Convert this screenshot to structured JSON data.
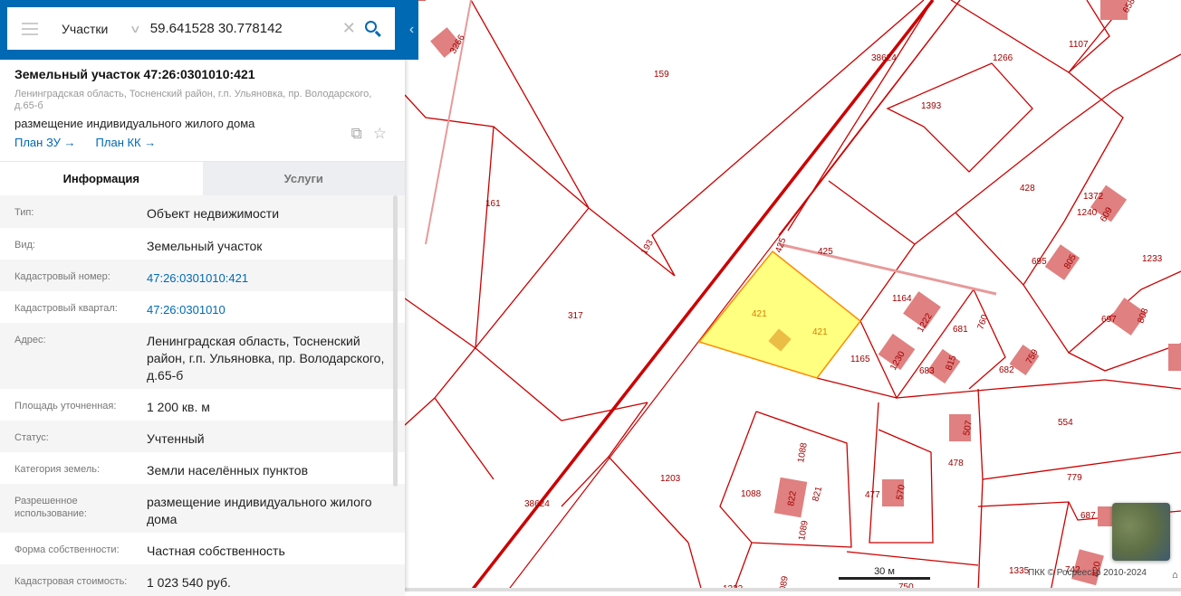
{
  "search": {
    "category": "Участки",
    "query": "59.641528 30.778142"
  },
  "card": {
    "title": "Земельный участок 47:26:0301010:421",
    "address": "Ленинградская область, Тосненский район, г.п. Ульяновка, пр. Володарского, д.65-б",
    "use": "размещение индивидуального жилого дома",
    "link_zu": "План ЗУ →",
    "link_kk": "План КК →"
  },
  "tabs": {
    "info": "Информация",
    "services": "Услуги"
  },
  "rows": [
    {
      "label": "Тип:",
      "value": "Объект недвижимости"
    },
    {
      "label": "Вид:",
      "value": "Земельный участок"
    },
    {
      "label": "Кадастровый номер:",
      "value": "47:26:0301010:421"
    },
    {
      "label": "Кадастровый квартал:",
      "value": "47:26:0301010"
    },
    {
      "label": "Адрес:",
      "value": "Ленинградская область, Тосненский район, г.п. Ульяновка, пр. Володарского, д.65-б"
    },
    {
      "label": "Площадь уточненная:",
      "value": "1 200 кв. м"
    },
    {
      "label": "Статус:",
      "value": "Учтенный"
    },
    {
      "label": "Категория земель:",
      "value": "Земли населённых пунктов"
    },
    {
      "label": "Разрешенное использование:",
      "value": "размещение индивидуального жилого дома"
    },
    {
      "label": "Форма собственности:",
      "value": "Частная собственность"
    },
    {
      "label": "Кадастровая стоимость:",
      "value": "1 023 540 руб."
    }
  ],
  "map": {
    "scale": "30 м",
    "attribution": "ПКК © Росреестр 2010-2024",
    "labels": [
      "159",
      "38624",
      "1266",
      "1107",
      "1393",
      "161",
      "428",
      "1372",
      "1240",
      "609",
      "193",
      "425",
      "425",
      "695",
      "805",
      "1233",
      "317",
      "421",
      "421",
      "1164",
      "1222",
      "681",
      "760",
      "697",
      "808",
      "1165",
      "1230",
      "683",
      "815",
      "682",
      "759",
      "554",
      "507",
      "478",
      "779",
      "1203",
      "1088",
      "1088",
      "822",
      "821",
      "477",
      "570",
      "687",
      "38624",
      "1089",
      "1335",
      "742",
      "820",
      "750",
      "1232",
      "089",
      "3266",
      "658"
    ]
  },
  "colors": {
    "accent": "#0069b4",
    "parcel": "#cc0000",
    "selected": "#ffff80"
  }
}
